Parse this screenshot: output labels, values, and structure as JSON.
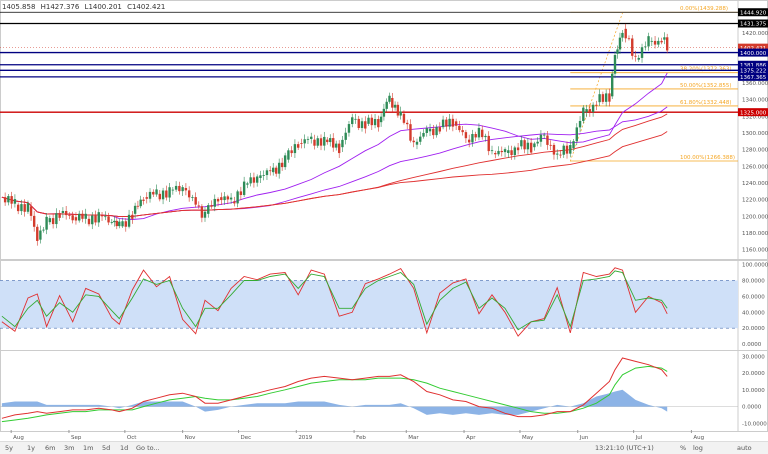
{
  "ohlc": {
    "open": "1405.858",
    "high": "H1427.376",
    "low": "L1400.201",
    "close": "C1402.421"
  },
  "price_labels": [
    {
      "text": "1444.920",
      "value": 1444.92,
      "bg": "#000000",
      "fg": "#ffffff"
    },
    {
      "text": "1431.375",
      "value": 1431.375,
      "bg": "#000000",
      "fg": "#ffffff"
    },
    {
      "text": "1402.421",
      "value": 1402.421,
      "bg": "#d33b2c",
      "fg": "#ffffff"
    },
    {
      "text": "1400.000",
      "value": 1396.5,
      "bg": "#000080",
      "fg": "#ffffff"
    },
    {
      "text": "1381.886",
      "value": 1381.886,
      "bg": "#000080",
      "fg": "#ffffff"
    },
    {
      "text": "1375.222",
      "value": 1375.222,
      "bg": "#000080",
      "fg": "#ffffff"
    },
    {
      "text": "1367.365",
      "value": 1367.365,
      "bg": "#000080",
      "fg": "#ffffff"
    },
    {
      "text": "1325.000",
      "value": 1325.0,
      "bg": "#cc0000",
      "fg": "#ffffff"
    }
  ],
  "fib_labels": [
    {
      "text": "0.00%(1439.288)",
      "value": 1444.92
    },
    {
      "text": "38.20%(1372.363)",
      "value": 1372.363
    },
    {
      "text": "50.00%(1352.855)",
      "value": 1352.855
    },
    {
      "text": "61.80%(1332.448)",
      "value": 1332.448
    },
    {
      "text": "100.00%(1266.388)",
      "value": 1266.388
    }
  ],
  "colors": {
    "up": "#2e8b57",
    "down": "#d33b2c",
    "fib": "#f5a623",
    "navy": "#000080",
    "ma_purple": "#a020f0",
    "ma_red": "#e03030",
    "stoch_k": "#e03030",
    "stoch_d": "#33aa33",
    "stoch_band": "#cfe0f8",
    "macd_line": "#e03030",
    "macd_signal": "#33cc33",
    "macd_hist": "#6fa0e0"
  },
  "footer": {
    "timeframes": [
      "5y",
      "1y",
      "6m",
      "3m",
      "1m",
      "5d",
      "1d",
      "Go to..."
    ],
    "clock": "13:21:10 (UTC+1)",
    "options": [
      "%",
      "log",
      "auto"
    ]
  },
  "chart_data": [
    {
      "type": "candlestick",
      "title": "",
      "x_tick_labels": [
        "Aug",
        "Sep",
        "Oct",
        "Nov",
        "Dec",
        "2019",
        "Feb",
        "Mar",
        "Apr",
        "May",
        "Jun",
        "Jul",
        "Aug"
      ],
      "y_tick_labels": [
        "1420.000",
        "1400.000",
        "1380.000",
        "1360.000",
        "1340.000",
        "1320.000",
        "1300.000",
        "1280.000",
        "1260.000",
        "1240.000",
        "1220.000",
        "1200.000",
        "1180.000",
        "1160.000"
      ],
      "ylim": [
        1150,
        1450
      ],
      "close_series": [
        {
          "d": "2018-07-27",
          "c": 1223
        },
        {
          "d": "2018-08-03",
          "c": 1214
        },
        {
          "d": "2018-08-10",
          "c": 1212
        },
        {
          "d": "2018-08-15",
          "c": 1172
        },
        {
          "d": "2018-08-20",
          "c": 1193
        },
        {
          "d": "2018-08-27",
          "c": 1204
        },
        {
          "d": "2018-09-03",
          "c": 1199
        },
        {
          "d": "2018-09-10",
          "c": 1197
        },
        {
          "d": "2018-09-17",
          "c": 1201
        },
        {
          "d": "2018-09-24",
          "c": 1193
        },
        {
          "d": "2018-09-28",
          "c": 1188
        },
        {
          "d": "2018-10-05",
          "c": 1203
        },
        {
          "d": "2018-10-11",
          "c": 1223
        },
        {
          "d": "2018-10-18",
          "c": 1227
        },
        {
          "d": "2018-10-25",
          "c": 1231
        },
        {
          "d": "2018-11-01",
          "c": 1234
        },
        {
          "d": "2018-11-08",
          "c": 1213
        },
        {
          "d": "2018-11-13",
          "c": 1203
        },
        {
          "d": "2018-11-20",
          "c": 1223
        },
        {
          "d": "2018-11-27",
          "c": 1218
        },
        {
          "d": "2018-12-04",
          "c": 1238
        },
        {
          "d": "2018-12-11",
          "c": 1246
        },
        {
          "d": "2018-12-18",
          "c": 1253
        },
        {
          "d": "2018-12-26",
          "c": 1268
        },
        {
          "d": "2019-01-02",
          "c": 1288
        },
        {
          "d": "2019-01-09",
          "c": 1292
        },
        {
          "d": "2019-01-16",
          "c": 1292
        },
        {
          "d": "2019-01-24",
          "c": 1283
        },
        {
          "d": "2019-01-31",
          "c": 1316
        },
        {
          "d": "2019-02-07",
          "c": 1311
        },
        {
          "d": "2019-02-14",
          "c": 1313
        },
        {
          "d": "2019-02-20",
          "c": 1342
        },
        {
          "d": "2019-02-26",
          "c": 1323
        },
        {
          "d": "2019-03-05",
          "c": 1286
        },
        {
          "d": "2019-03-12",
          "c": 1302
        },
        {
          "d": "2019-03-19",
          "c": 1307
        },
        {
          "d": "2019-03-26",
          "c": 1314
        },
        {
          "d": "2019-04-02",
          "c": 1292
        },
        {
          "d": "2019-04-09",
          "c": 1304
        },
        {
          "d": "2019-04-16",
          "c": 1276
        },
        {
          "d": "2019-04-23",
          "c": 1276
        },
        {
          "d": "2019-04-30",
          "c": 1284
        },
        {
          "d": "2019-05-07",
          "c": 1283
        },
        {
          "d": "2019-05-14",
          "c": 1297
        },
        {
          "d": "2019-05-21",
          "c": 1274
        },
        {
          "d": "2019-05-28",
          "c": 1282
        },
        {
          "d": "2019-06-04",
          "c": 1325
        },
        {
          "d": "2019-06-11",
          "c": 1337
        },
        {
          "d": "2019-06-18",
          "c": 1344
        },
        {
          "d": "2019-06-21",
          "c": 1395
        },
        {
          "d": "2019-06-25",
          "c": 1425
        },
        {
          "d": "2019-07-02",
          "c": 1388
        },
        {
          "d": "2019-07-09",
          "c": 1410
        },
        {
          "d": "2019-07-16",
          "c": 1412
        },
        {
          "d": "2019-07-19",
          "c": 1402
        }
      ]
    },
    {
      "type": "line",
      "y_tick_labels": [
        "100.0000",
        "80.0000",
        "60.0000",
        "40.0000",
        "20.0000",
        "0.0000"
      ],
      "ylim": [
        -5,
        102
      ],
      "band": [
        20,
        80
      ],
      "series": [
        {
          "values": [
            28,
            16,
            58,
            63,
            22,
            61,
            28,
            70,
            63,
            33,
            25,
            68,
            93,
            72,
            85,
            31,
            13,
            55,
            42,
            70,
            85,
            81,
            88,
            90,
            62,
            93,
            88,
            35,
            40,
            76,
            82,
            88,
            95,
            70,
            14,
            64,
            77,
            82,
            38,
            62,
            40,
            10,
            28,
            32,
            71,
            14,
            90,
            85,
            88,
            96,
            93,
            40,
            60,
            52,
            38
          ]
        },
        {
          "values": [
            35,
            22,
            45,
            55,
            35,
            52,
            40,
            62,
            60,
            42,
            32,
            58,
            82,
            75,
            80,
            45,
            22,
            45,
            45,
            62,
            80,
            80,
            85,
            88,
            70,
            88,
            85,
            45,
            45,
            70,
            80,
            85,
            90,
            75,
            25,
            55,
            70,
            78,
            45,
            58,
            45,
            18,
            28,
            30,
            62,
            22,
            80,
            82,
            85,
            92,
            90,
            55,
            58,
            55,
            45
          ]
        }
      ]
    },
    {
      "type": "line",
      "y_tick_labels": [
        "30.0000",
        "20.0000",
        "10.0000",
        "0.0000",
        "-10.0000"
      ],
      "ylim": [
        -14,
        32
      ],
      "series": [
        {
          "values": [
            -7,
            -5,
            -4,
            -3,
            -4,
            -3,
            -2,
            -2,
            -1,
            -2,
            -3,
            -1,
            3,
            5,
            7,
            8,
            6,
            2,
            2,
            4,
            6,
            8,
            10,
            12,
            15,
            17,
            18,
            17,
            16,
            17,
            18,
            18,
            19,
            15,
            9,
            7,
            4,
            3,
            0,
            -1,
            -4,
            -6,
            -6,
            -5,
            -3,
            -3,
            1,
            8,
            15,
            22,
            29,
            27,
            25,
            22,
            18
          ]
        },
        {
          "values": [
            -9,
            -8,
            -7,
            -6,
            -5,
            -4,
            -3,
            -3,
            -2,
            -2,
            -2,
            -2,
            0,
            2,
            4,
            5,
            6,
            5,
            4,
            4,
            5,
            6,
            8,
            10,
            12,
            14,
            15,
            16,
            16,
            16,
            17,
            17,
            17,
            16,
            14,
            11,
            9,
            7,
            5,
            3,
            1,
            -1,
            -3,
            -4,
            -4,
            -3,
            -1,
            2,
            7,
            13,
            19,
            23,
            24,
            23,
            21
          ]
        },
        {
          "values": [
            2,
            3,
            3,
            3,
            1,
            1,
            1,
            1,
            1,
            0,
            -1,
            1,
            3,
            3,
            3,
            3,
            0,
            -3,
            -2,
            0,
            1,
            2,
            2,
            2,
            3,
            3,
            3,
            1,
            0,
            1,
            1,
            1,
            2,
            -1,
            -5,
            -4,
            -5,
            -4,
            -5,
            -4,
            -5,
            -5,
            -3,
            -1,
            1,
            0,
            2,
            6,
            8,
            9,
            10,
            4,
            1,
            -1,
            -3
          ]
        }
      ]
    }
  ]
}
